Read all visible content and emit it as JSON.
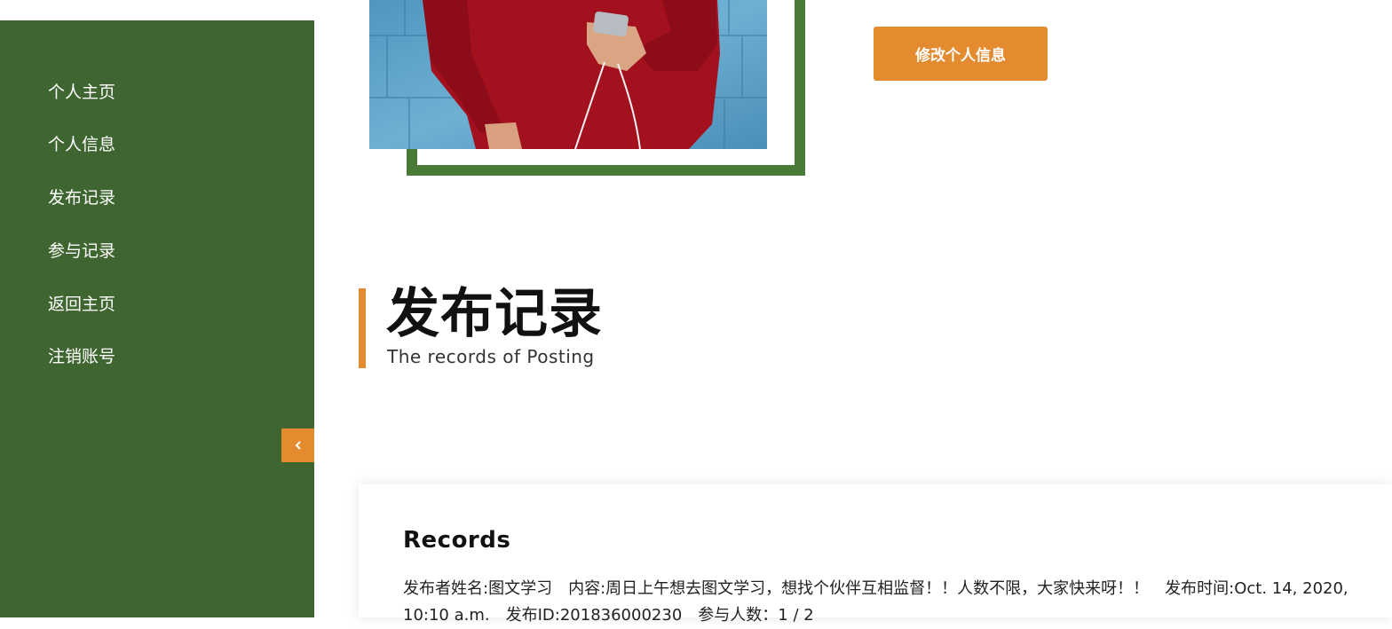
{
  "sidebar": {
    "items": [
      {
        "label": "个人主页"
      },
      {
        "label": "个人信息"
      },
      {
        "label": "发布记录"
      },
      {
        "label": "参与记录"
      },
      {
        "label": "返回主页"
      },
      {
        "label": "注销账号"
      }
    ],
    "collapse_icon": "chevron-left-icon"
  },
  "profile": {
    "edit_button_label": "修改个人信息"
  },
  "section": {
    "title": "发布记录",
    "subtitle": "The records of Posting"
  },
  "records": {
    "card_title": "Records",
    "items": [
      {
        "publisher": "发布者姓名:图文学习",
        "content": "内容:周日上午想去图文学习，想找个伙伴互相监督！！人数不限，大家快来呀！！",
        "time": "发布时间:Oct. 14, 2020, 10:10 a.m.",
        "post_id": "发布ID:201836000230",
        "participants": "参与人数：1 / 2"
      }
    ]
  },
  "colors": {
    "sidebar_bg": "#3f6630",
    "accent": "#e48a2f",
    "frame": "#4a7a38"
  }
}
